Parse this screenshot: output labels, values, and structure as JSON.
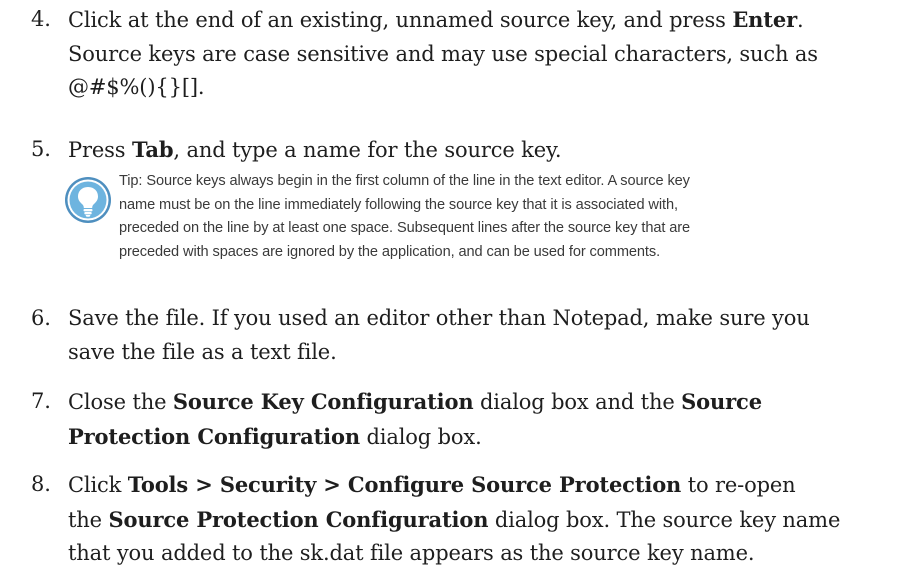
{
  "steps": [
    {
      "number": "4.",
      "lines": [
        {
          "parts": [
            {
              "t": "Click at the end of an existing, unnamed source key, and press "
            },
            {
              "t": "Enter",
              "b": true
            },
            {
              "t": "."
            }
          ]
        },
        {
          "parts": [
            {
              "t": "Source keys are case sensitive and may use special characters, such as"
            }
          ]
        },
        {
          "parts": [
            {
              "t": "@#$%(){}[]."
            }
          ]
        }
      ]
    },
    {
      "number": "5.",
      "lines": [
        {
          "parts": [
            {
              "t": "Press "
            },
            {
              "t": "Tab",
              "b": true
            },
            {
              "t": ", and type a name for the source key."
            }
          ]
        }
      ]
    },
    {
      "number": "6.",
      "lines": [
        {
          "parts": [
            {
              "t": "Save the file. If you used an editor other than Notepad, make sure you"
            }
          ]
        },
        {
          "parts": [
            {
              "t": "save the file as a text file."
            }
          ]
        }
      ]
    },
    {
      "number": "7.",
      "lines": [
        {
          "parts": [
            {
              "t": "Close the "
            },
            {
              "t": "Source Key Configuration",
              "b": true
            },
            {
              "t": " dialog box and the "
            },
            {
              "t": "Source",
              "b": true
            }
          ]
        },
        {
          "parts": [
            {
              "t": "Protection Configuration",
              "b": true
            },
            {
              "t": " dialog box."
            }
          ]
        }
      ]
    },
    {
      "number": "8.",
      "lines": [
        {
          "parts": [
            {
              "t": "Click "
            },
            {
              "t": "Tools > Security > Configure Source Protection",
              "b": true
            },
            {
              "t": " to re-open"
            }
          ]
        },
        {
          "parts": [
            {
              "t": "the "
            },
            {
              "t": "Source Protection Configuration",
              "b": true
            },
            {
              "t": " dialog box. The source key name"
            }
          ]
        },
        {
          "parts": [
            {
              "t": "that you added to the sk.dat file appears as the source key name."
            }
          ]
        }
      ]
    }
  ],
  "tip": {
    "icon": "lightbulb-icon",
    "lines": [
      "Tip: Source keys always begin in the first column of the line in the text editor. A source key",
      "name must be on the line immediately following the source key that it is associated with,",
      "preceded on the line by at least one space. Subsequent lines after the source key that are",
      "preceded with spaces are ignored by the application, and can be used for comments."
    ],
    "colors": {
      "ring": "#5fa0c8",
      "inner": "#7bbfe6",
      "bulb": "#ffffff"
    }
  }
}
